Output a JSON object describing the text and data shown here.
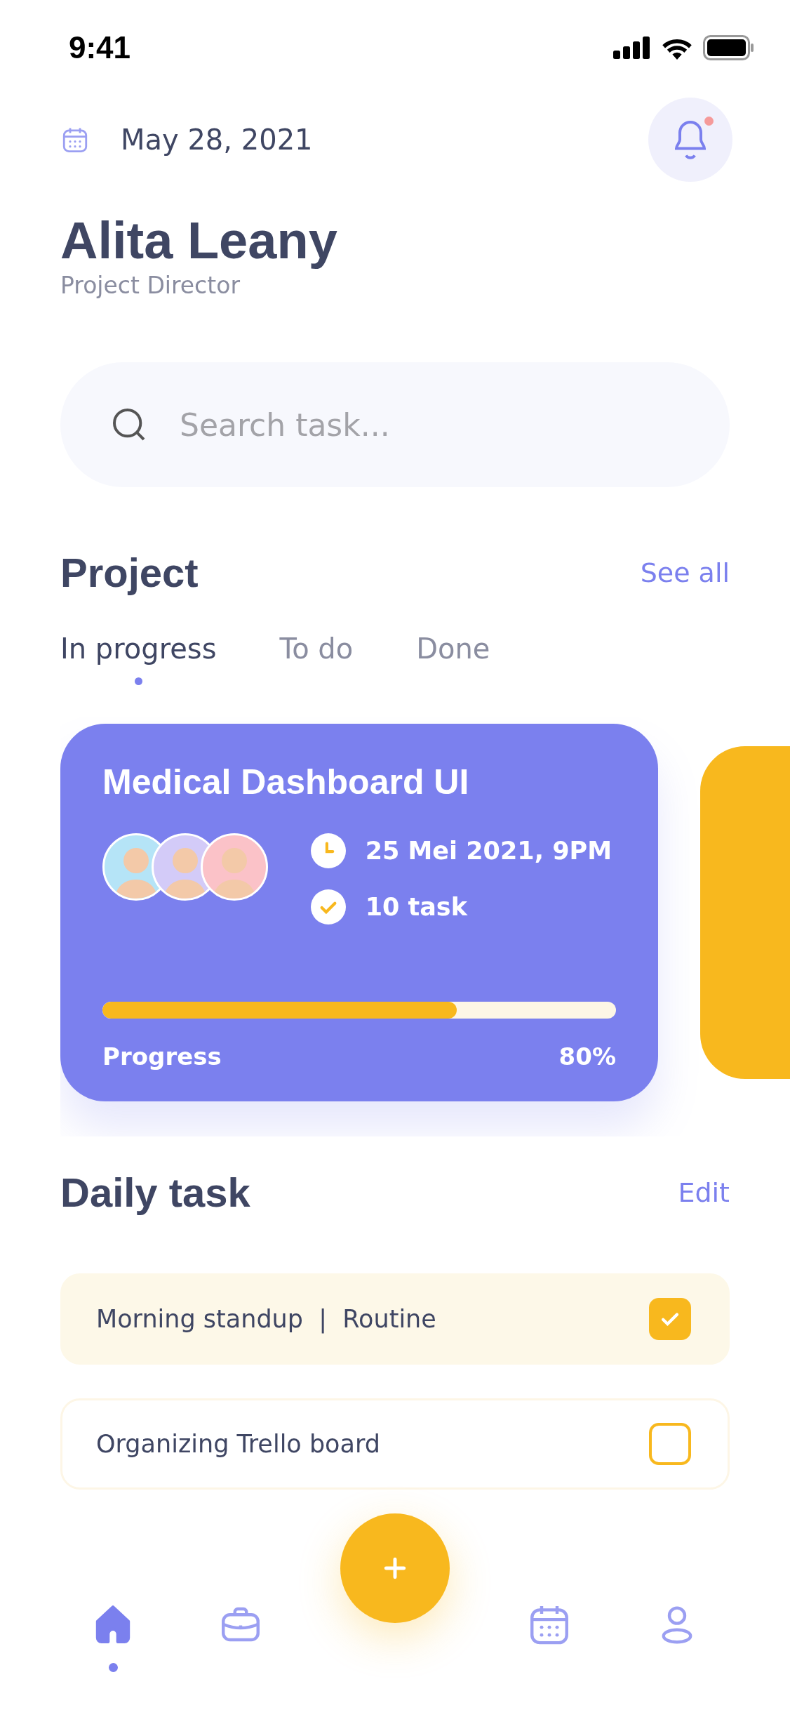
{
  "status_bar": {
    "time": "9:41"
  },
  "header": {
    "date": "May 28, 2021",
    "notification_unread": true,
    "name": "Alita Leany",
    "role": "Project Director"
  },
  "search": {
    "placeholder": "Search task..."
  },
  "project": {
    "title": "Project",
    "link": "See all",
    "tabs": [
      {
        "label": "In progress",
        "selected": true
      },
      {
        "label": "To do",
        "selected": false
      },
      {
        "label": "Done",
        "selected": false
      }
    ],
    "cards": [
      {
        "title": "Medical Dashboard UI",
        "color": "#7b80ee",
        "avatars": [
          {
            "color": "#b5e4f7"
          },
          {
            "color": "#d3cbf8"
          },
          {
            "color": "#fbc2c8"
          }
        ],
        "due": "25 Mei 2021, 9PM",
        "tasks": "10 task",
        "level": 0.69,
        "progress_label": "Progress",
        "percent": "80%"
      },
      {
        "color": "#f8b81e"
      }
    ]
  },
  "daily": {
    "title": "Daily task",
    "link": "Edit",
    "tasks": [
      {
        "label": "Morning standup  |  Routine",
        "checked": true
      },
      {
        "label": "Organizing Trello board",
        "checked": false
      }
    ]
  },
  "nav": [
    {
      "kind": "home",
      "selected": true
    },
    {
      "kind": "briefcase",
      "selected": false
    },
    {
      "kind": "add"
    },
    {
      "kind": "calendar",
      "selected": false
    },
    {
      "kind": "profile",
      "selected": false
    }
  ]
}
